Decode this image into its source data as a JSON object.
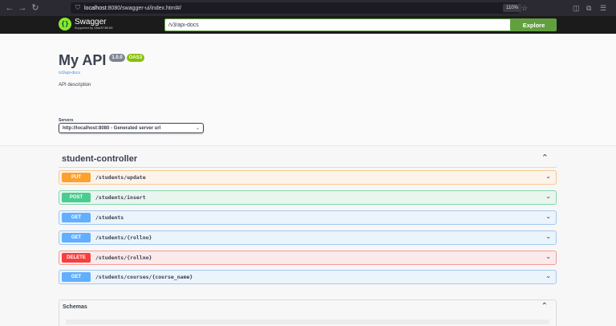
{
  "browser": {
    "back": "←",
    "forward": "→",
    "reload": "↻",
    "url_host": "localhost",
    "url_rest": ":8080/swagger-ui/index.html#/",
    "zoom": "110%"
  },
  "topbar": {
    "logo_title": "Swagger",
    "logo_sub": "Supported by SMARTBEAR",
    "spec_url": "/v3/api-docs",
    "explore_label": "Explore",
    "accent": "#62a03f"
  },
  "info": {
    "title": "My API",
    "version": "1.0.0",
    "oas": "OAS3",
    "docs_link": "/v3/api-docs",
    "description": "API description"
  },
  "servers": {
    "label": "Servers",
    "selected": "http://localhost:8080 - Generated server url"
  },
  "controller": {
    "name": "student-controller",
    "operations": [
      {
        "method": "PUT",
        "path": "/students/update"
      },
      {
        "method": "POST",
        "path": "/students/insert"
      },
      {
        "method": "GET",
        "path": "/students"
      },
      {
        "method": "GET",
        "path": "/students/{rollno}"
      },
      {
        "method": "DELETE",
        "path": "/students/{rollno}"
      },
      {
        "method": "GET",
        "path": "/students/courses/{course_name}"
      }
    ]
  },
  "schemas": {
    "title": "Schemas"
  },
  "colors": {
    "put": "#fca130",
    "post": "#49cc90",
    "get": "#61affe",
    "delete": "#f93e3e"
  }
}
